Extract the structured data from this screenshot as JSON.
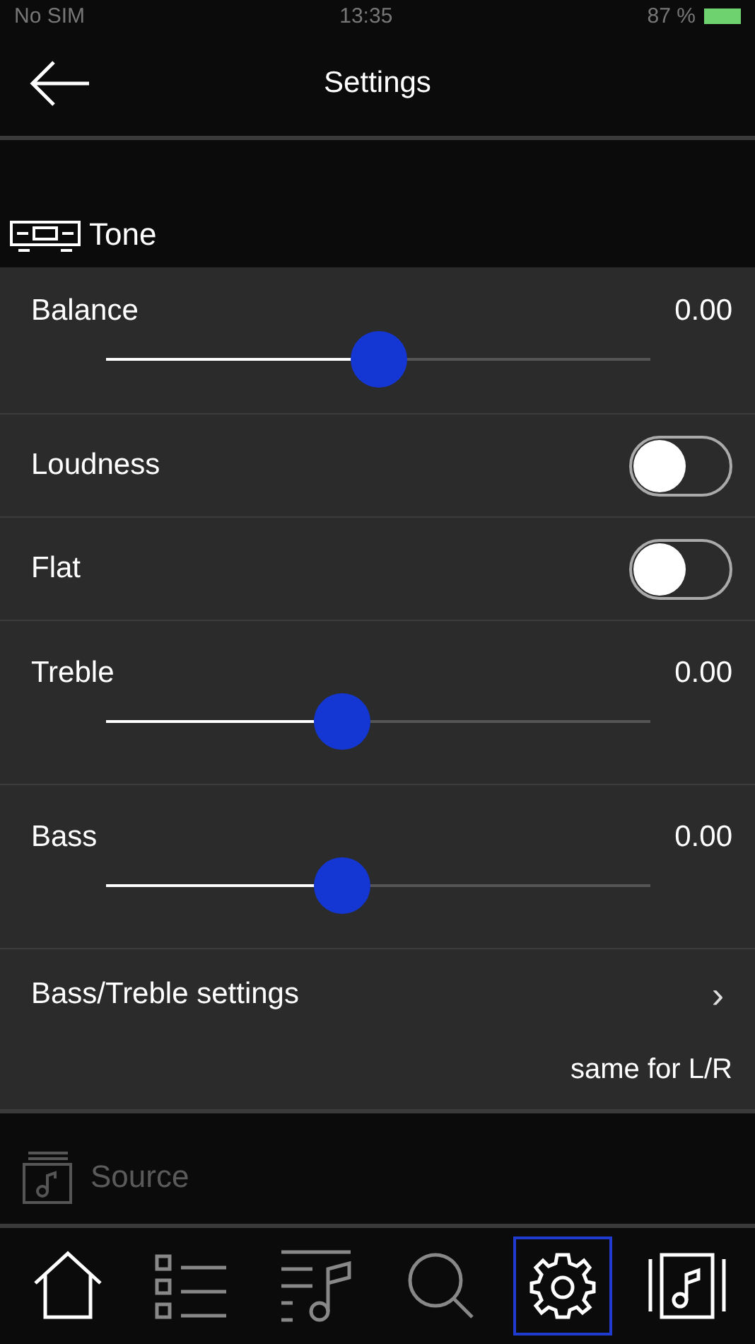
{
  "status_bar": {
    "carrier": "No SIM",
    "time": "13:35",
    "battery": "87 %"
  },
  "nav": {
    "title": "Settings"
  },
  "section": {
    "title": "Tone"
  },
  "rows": [
    {
      "kind": "slider",
      "label": "Balance",
      "reading": "0.00",
      "level": 0.5
    },
    {
      "kind": "switch",
      "label": "Loudness",
      "on": false
    },
    {
      "kind": "switch",
      "label": "Flat",
      "on": false
    },
    {
      "kind": "slider",
      "label": "Treble",
      "reading": "0.00",
      "level": 0.435
    },
    {
      "kind": "slider",
      "label": "Bass",
      "reading": "0.00",
      "level": 0.435
    },
    {
      "kind": "link",
      "label": "Bass/Treble settings",
      "chevron": "›",
      "value": "same for L/R"
    }
  ],
  "next_section": {
    "title": "Source",
    "disabled": true
  },
  "tabs": [
    {
      "kind": "home",
      "selected": false,
      "disabled": false
    },
    {
      "kind": "list",
      "selected": false,
      "disabled": true
    },
    {
      "kind": "queue",
      "selected": false,
      "disabled": true
    },
    {
      "kind": "search",
      "selected": false,
      "disabled": true
    },
    {
      "kind": "settings",
      "selected": true,
      "disabled": false
    },
    {
      "kind": "player",
      "selected": false,
      "disabled": false
    }
  ]
}
